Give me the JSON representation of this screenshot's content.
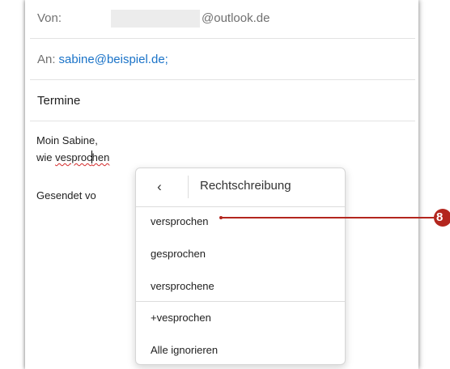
{
  "header": {
    "from_label": "Von:",
    "from_domain": "@outlook.de",
    "to_label": "An:",
    "to_value": "sabine@beispiel.de;",
    "subject": "Termine"
  },
  "body": {
    "greeting": "Moin Sabine,",
    "line2_prefix": "wie ",
    "misspelled_part1": "vesproc",
    "misspelled_part2": "hen",
    "signature_partial": "Gesendet vo"
  },
  "spellcheck_menu": {
    "back_glyph": "‹",
    "title": "Rechtschreibung",
    "suggestions": [
      "versprochen",
      "gesprochen",
      "versprochene"
    ],
    "actions": [
      "+vesprochen",
      "Alle ignorieren"
    ]
  },
  "callout": {
    "number": "8",
    "color": "#b3261e"
  }
}
